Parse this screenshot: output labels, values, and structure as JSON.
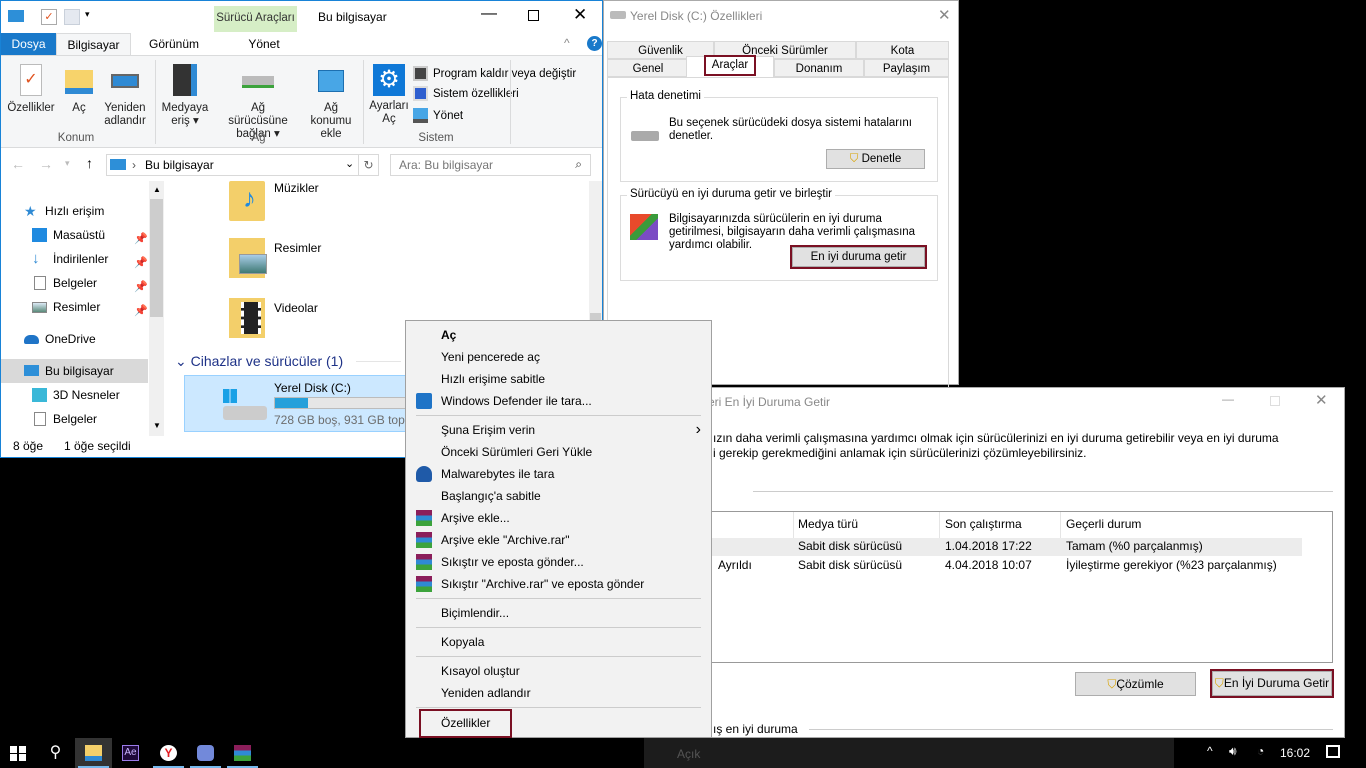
{
  "explorer": {
    "title": "Bu bilgisayar",
    "context_tab": "Sürücü Araçları",
    "context_sub": "Yönet",
    "tabs": [
      "Dosya",
      "Bilgisayar",
      "Görünüm"
    ],
    "ribbon": {
      "konum": {
        "label": "Konum",
        "items": [
          "Özellikler",
          "Aç",
          "Yeniden adlandır"
        ]
      },
      "ag": {
        "label": "Ağ",
        "items": [
          "Medyaya eriş",
          "Ağ sürücüsüne bağlan",
          "Ağ konumu ekle"
        ]
      },
      "sistem": {
        "label": "Sistem",
        "ayarlar": "Ayarları Aç",
        "items": [
          "Program kaldır veya değiştir",
          "Sistem özellikleri",
          "Yönet"
        ]
      }
    },
    "address": "Bu bilgisayar",
    "search_placeholder": "Ara: Bu bilgisayar",
    "nav": [
      {
        "label": "Hızlı erişim",
        "pinned": false
      },
      {
        "label": "Masaüstü",
        "pinned": true
      },
      {
        "label": "İndirilenler",
        "pinned": true
      },
      {
        "label": "Belgeler",
        "pinned": true
      },
      {
        "label": "Resimler",
        "pinned": true
      },
      {
        "label": "OneDrive",
        "pinned": false
      },
      {
        "label": "Bu bilgisayar",
        "pinned": false
      },
      {
        "label": "3D Nesneler",
        "pinned": false
      },
      {
        "label": "Belgeler",
        "pinned": false
      }
    ],
    "folders": [
      "Müzikler",
      "Resimler",
      "Videolar"
    ],
    "group_header": "Cihazlar ve sürücüler (1)",
    "drive": {
      "name": "Yerel Disk (C:)",
      "info": "728 GB boş, 931 GB toplam",
      "used_percent": 22
    },
    "status_count": "8 öğe",
    "status_selected": "1 öğe seçildi"
  },
  "properties": {
    "title": "Yerel Disk (C:) Özellikleri",
    "tabs_row1": [
      "Güvenlik",
      "Önceki Sürümler",
      "Kota"
    ],
    "tabs_row2": [
      "Genel",
      "Araçlar",
      "Donanım",
      "Paylaşım"
    ],
    "error_group": "Hata denetimi",
    "error_text": "Bu seçenek sürücüdeki dosya sistemi hatalarını denetler.",
    "error_button": "Denetle",
    "opt_group": "Sürücüyü en iyi duruma getir ve birleştir",
    "opt_text": "Bilgisayarınızda sürücülerin en iyi duruma getirilmesi, bilgisayarın daha verimli çalışmasına yardımcı olabilir.",
    "opt_button": "En iyi duruma getir"
  },
  "context_menu": [
    {
      "label": "Aç",
      "bold": true
    },
    {
      "label": "Yeni pencerede aç"
    },
    {
      "label": "Hızlı erişime sabitle"
    },
    {
      "label": "Windows Defender ile tara...",
      "icon": "defender"
    },
    {
      "sep": true
    },
    {
      "label": "Şuna Erişim verin",
      "submenu": true
    },
    {
      "label": "Önceki Sürümleri Geri Yükle"
    },
    {
      "label": "Malwarebytes ile tara",
      "icon": "malwarebytes"
    },
    {
      "label": "Başlangıç'a sabitle"
    },
    {
      "label": "Arşive ekle...",
      "icon": "winrar"
    },
    {
      "label": "Arşive ekle \"Archive.rar\"",
      "icon": "winrar"
    },
    {
      "label": "Sıkıştır ve eposta gönder...",
      "icon": "winrar"
    },
    {
      "label": "Sıkıştır \"Archive.rar\" ve eposta gönder",
      "icon": "winrar"
    },
    {
      "sep": true
    },
    {
      "label": "Biçimlendir..."
    },
    {
      "sep": true
    },
    {
      "label": "Kopyala"
    },
    {
      "sep": true
    },
    {
      "label": "Kısayol oluştur"
    },
    {
      "label": "Yeniden adlandır"
    },
    {
      "sep": true
    },
    {
      "label": "Özellikler",
      "highlight": true
    }
  ],
  "optimize": {
    "title": "eri En İyi Duruma Getir",
    "desc1": "ızın daha verimli çalışmasına yardımcı olmak için sürücülerinizi en iyi duruma getirebilir veya en iyi duruma",
    "desc2": "i gerekip gerekmediğini anlamak için sürücülerinizi çözümleyebilirsiniz.",
    "columns": [
      "Medya türü",
      "Son çalıştırma",
      "Geçerli durum"
    ],
    "rows": [
      {
        "status_prefix": "",
        "media": "Sabit disk sürücüsü",
        "last_run": "1.04.2018 17:22",
        "state": "Tamam (%0 parçalanmış)"
      },
      {
        "status_prefix": "Ayrıldı",
        "media": "Sabit disk sürücüsü",
        "last_run": "4.04.2018 10:07",
        "state": "İyileştirme gerekiyor (%23 parçalanmış)"
      }
    ],
    "analyze_button": "Çözümle",
    "optimize_button": "En İyi Duruma Getir",
    "scheduled_label": "ış en iyi duruma",
    "scheduled_value": "Açık"
  },
  "taskbar": {
    "time": "16:02",
    "apps": [
      "file-explorer",
      "after-effects",
      "yandex",
      "discord",
      "winrar"
    ],
    "ae_label": "Ae"
  },
  "colors": {
    "accent": "#1979ca",
    "highlight": "#7a1023",
    "selection": "#cce8ff"
  }
}
